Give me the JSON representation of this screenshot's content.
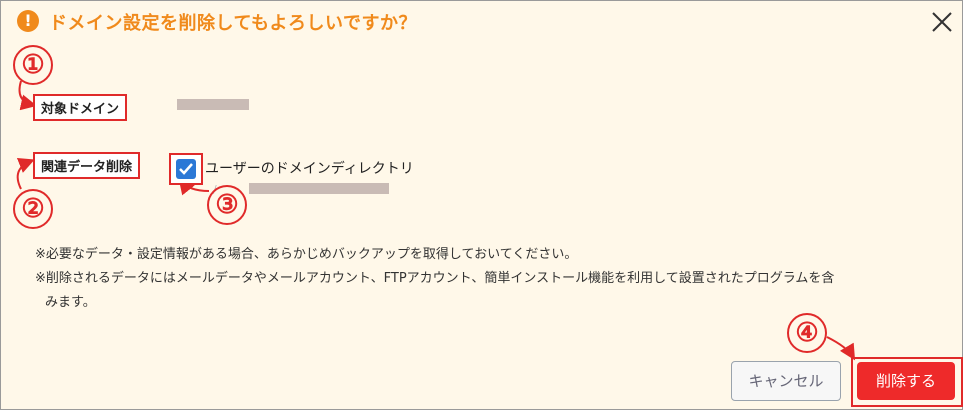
{
  "dialog": {
    "title": "ドメイン設定を削除してもよろしいですか？",
    "warning_icon": "exclamation-icon",
    "close_icon": "close-icon"
  },
  "fields": {
    "target_domain_label": "対象ドメイン",
    "related_data_label": "関連データ削除",
    "checkbox_label": "ユーザーのドメインディレクトリ",
    "checkbox_checked": true
  },
  "annotations": [
    "①",
    "②",
    "③",
    "④"
  ],
  "notes": {
    "line1": "※必要なデータ・設定情報がある場合、あらかじめバックアップを取得しておいてください。",
    "line2": "※削除されるデータにはメールデータやメールアカウント、FTPアカウント、簡単インストール機能を利用して設置されたプログラムを含",
    "line3": "みます。"
  },
  "buttons": {
    "cancel": "キャンセル",
    "delete": "削除する"
  },
  "colors": {
    "background": "#fff8e9",
    "title": "#f08a1c",
    "annotation": "#e02a2a",
    "delete_button": "#ee2a2a",
    "checkbox": "#2b78d6"
  }
}
